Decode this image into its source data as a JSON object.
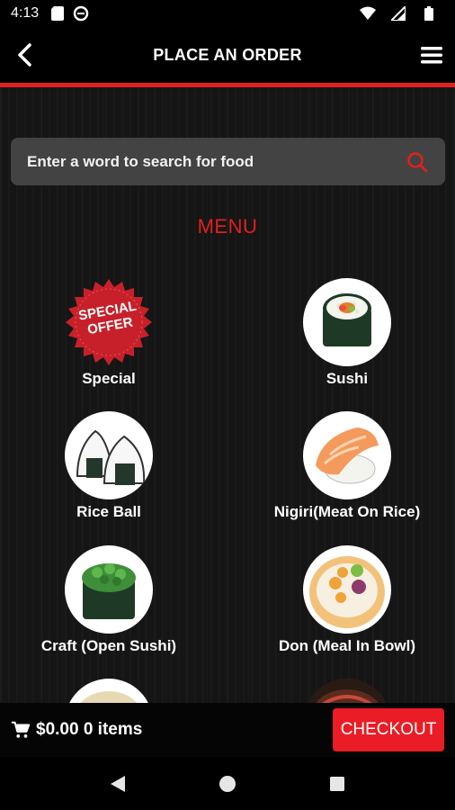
{
  "status_bar": {
    "time": "4:13"
  },
  "header": {
    "title": "PLACE AN ORDER"
  },
  "search": {
    "placeholder": "Enter a word to search for food"
  },
  "menu": {
    "title": "MENU",
    "items": [
      {
        "label": "Special",
        "badge_line1": "SPECIAL",
        "badge_line2": "OFFER"
      },
      {
        "label": "Sushi"
      },
      {
        "label": "Rice Ball"
      },
      {
        "label": "Nigiri(Meat On Rice)"
      },
      {
        "label": "Craft (Open Sushi)"
      },
      {
        "label": "Don (Meal In Bowl)"
      }
    ]
  },
  "cart": {
    "summary": "$0.00 0 items",
    "checkout_label": "CHECKOUT"
  },
  "colors": {
    "accent": "#e0201e",
    "checkout": "#ea1c25",
    "search_bg": "#434343"
  }
}
